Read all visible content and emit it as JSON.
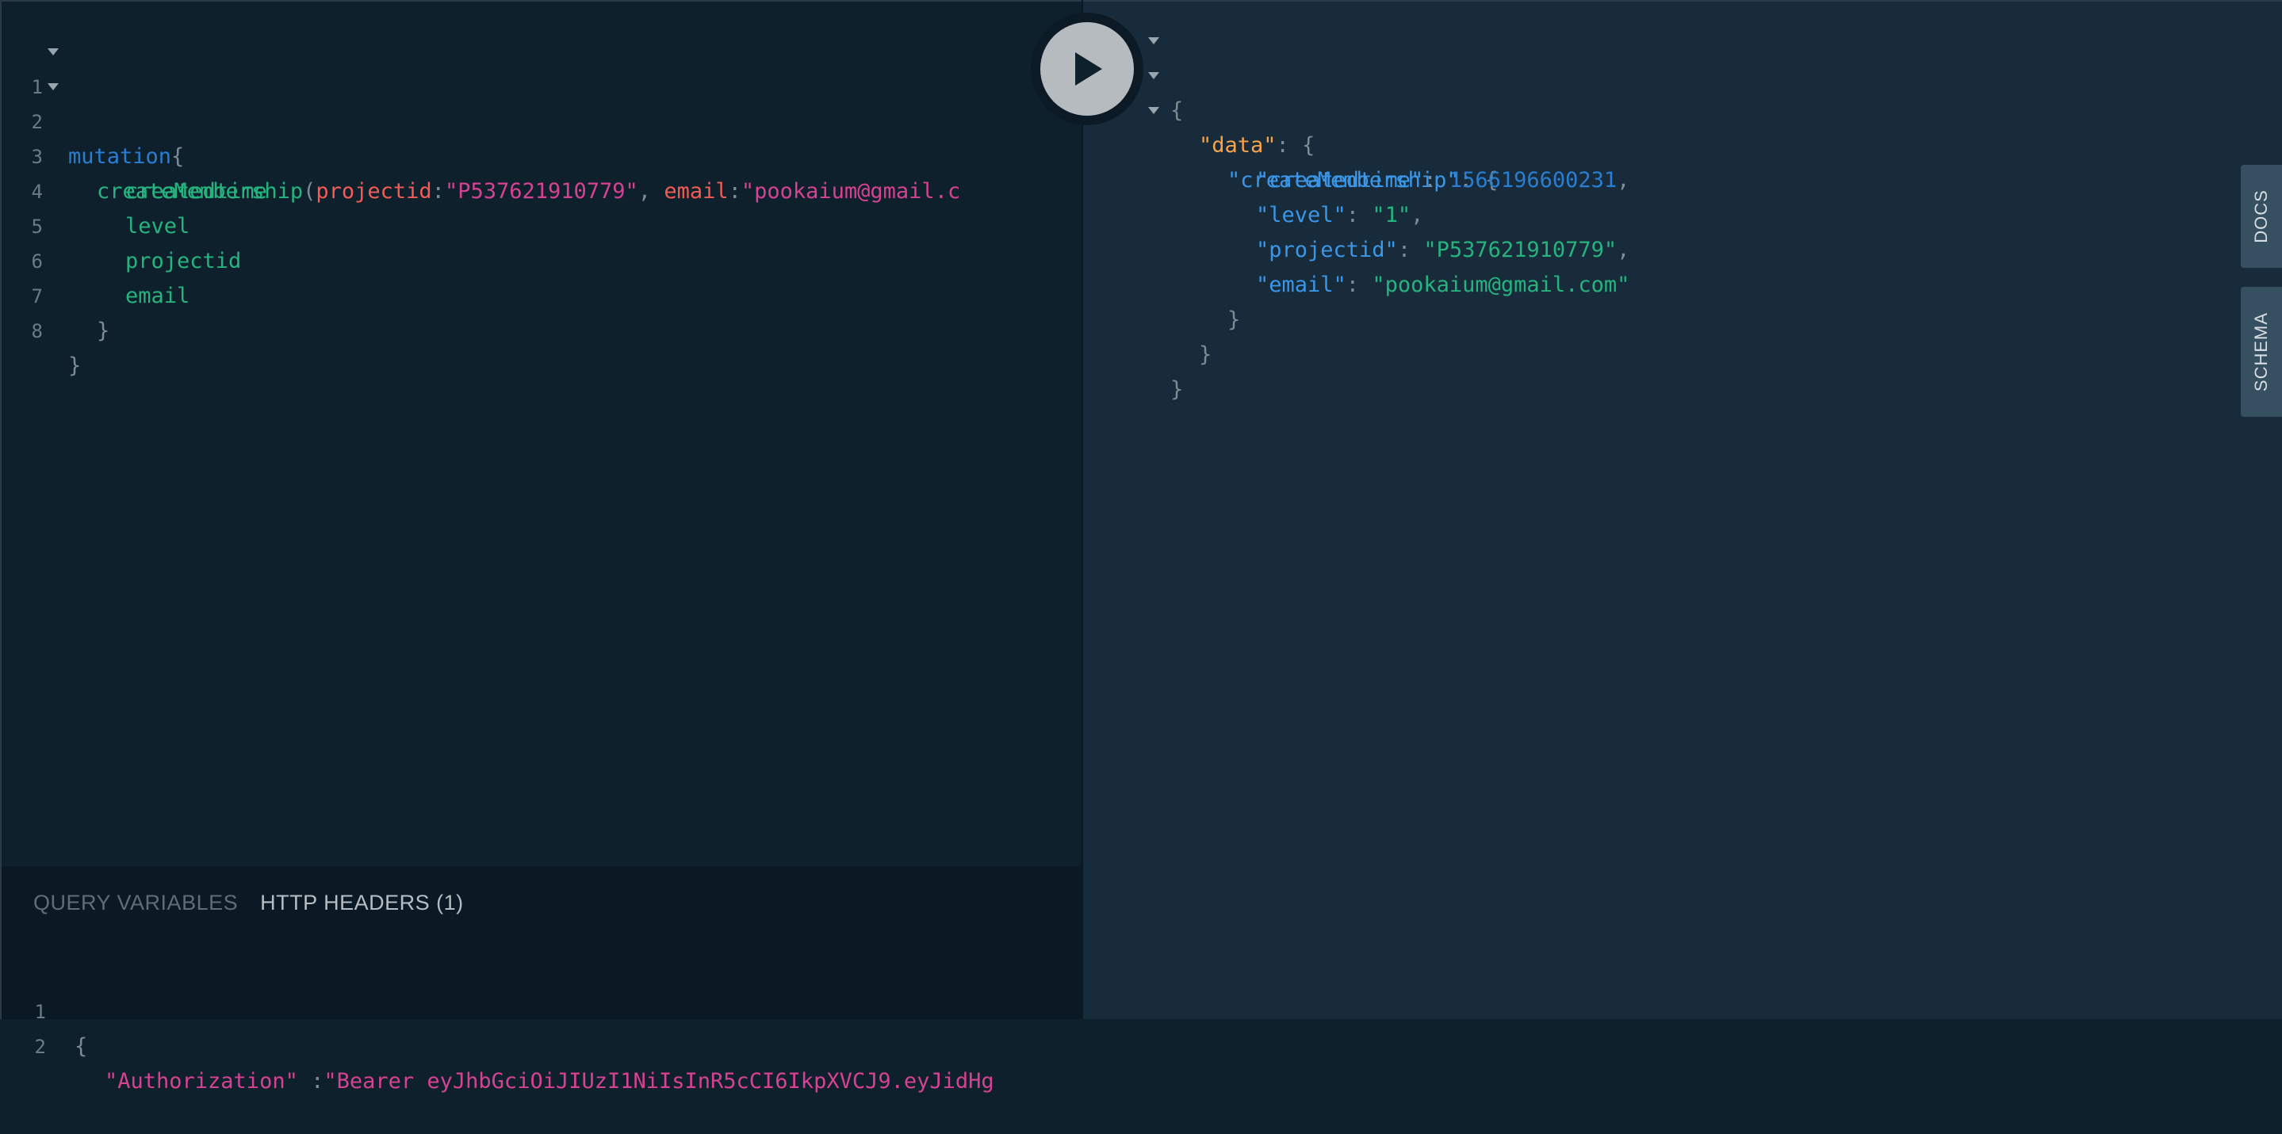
{
  "query_editor": {
    "line_numbers": [
      "1",
      "2",
      "3",
      "4",
      "5",
      "6",
      "7",
      "8"
    ],
    "mutation_keyword": "mutation",
    "open_brace": "{",
    "operation_name": "createMembership",
    "open_paren": "(",
    "arg1_name": "projectid",
    "colon": ":",
    "arg1_value": "\"P537621910779\"",
    "comma": ",",
    "arg2_name": "email",
    "arg2_value": "\"pookaium@gmail.c",
    "fields": [
      "createdtime",
      "level",
      "projectid",
      "email"
    ],
    "close_brace": "}"
  },
  "result_viewer": {
    "open_brace": "{",
    "data_key": "\"data\"",
    "colon_brace": ": {",
    "op_key": "\"createMembership\"",
    "rows": [
      {
        "key": "\"createdtime\"",
        "value": "1566196600231",
        "type": "num",
        "trail": ","
      },
      {
        "key": "\"level\"",
        "value": "\"1\"",
        "type": "str",
        "trail": ","
      },
      {
        "key": "\"projectid\"",
        "value": "\"P537621910779\"",
        "type": "str",
        "trail": ","
      },
      {
        "key": "\"email\"",
        "value": "\"pookaium@gmail.com\"",
        "type": "str",
        "trail": ""
      }
    ],
    "close_brace": "}"
  },
  "bottom_panel": {
    "tabs": [
      {
        "label": "QUERY VARIABLES",
        "active": false
      },
      {
        "label": "HTTP HEADERS (1)",
        "active": true
      }
    ],
    "line_numbers": [
      "1",
      "2"
    ],
    "line1": "{",
    "line2_key": "\"Authorization\"",
    "line2_sep": " :",
    "line2_value": "\"Bearer eyJhbGciOiJIUzI1NiIsInR5cCI6IkpXVCJ9.eyJidHg"
  },
  "side_tabs": {
    "docs": "DOCS",
    "schema": "SCHEMA"
  },
  "icons": {
    "run": "play-icon",
    "fold": "chevron-down-icon"
  }
}
